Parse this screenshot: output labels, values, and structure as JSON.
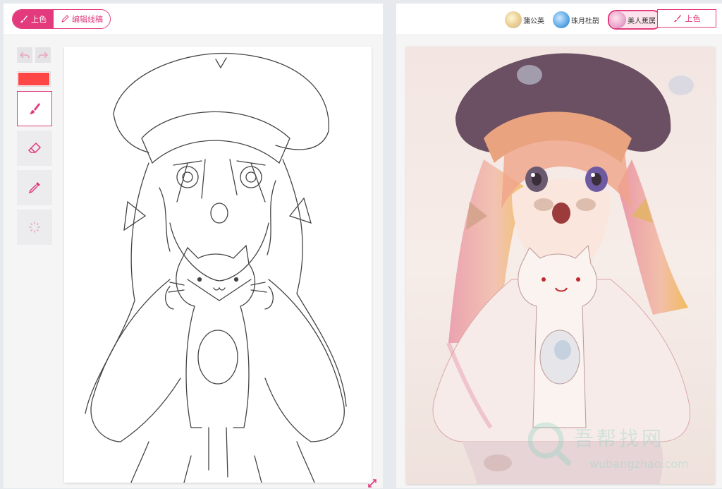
{
  "left_panel": {
    "mode_tabs": [
      {
        "label": "上色",
        "active": true
      },
      {
        "label": "编辑线稿",
        "active": false
      }
    ],
    "current_color": "#ff4646",
    "tools": [
      "brush-icon",
      "eraser-icon",
      "eyedropper-icon",
      "loading-spinner-icon"
    ],
    "active_tool": "brush"
  },
  "right_panel": {
    "styles": [
      {
        "label": "蒲公英",
        "active": false
      },
      {
        "label": "珠月杜鹃",
        "active": false
      },
      {
        "label": "美人蕉属",
        "active": true
      }
    ],
    "colorize_label": "上色"
  },
  "watermark": {
    "name": "吾帮找网",
    "url": "wubangzhao.com"
  },
  "colors": {
    "accent": "#e23a7c",
    "selected_color": "#ff4646"
  }
}
